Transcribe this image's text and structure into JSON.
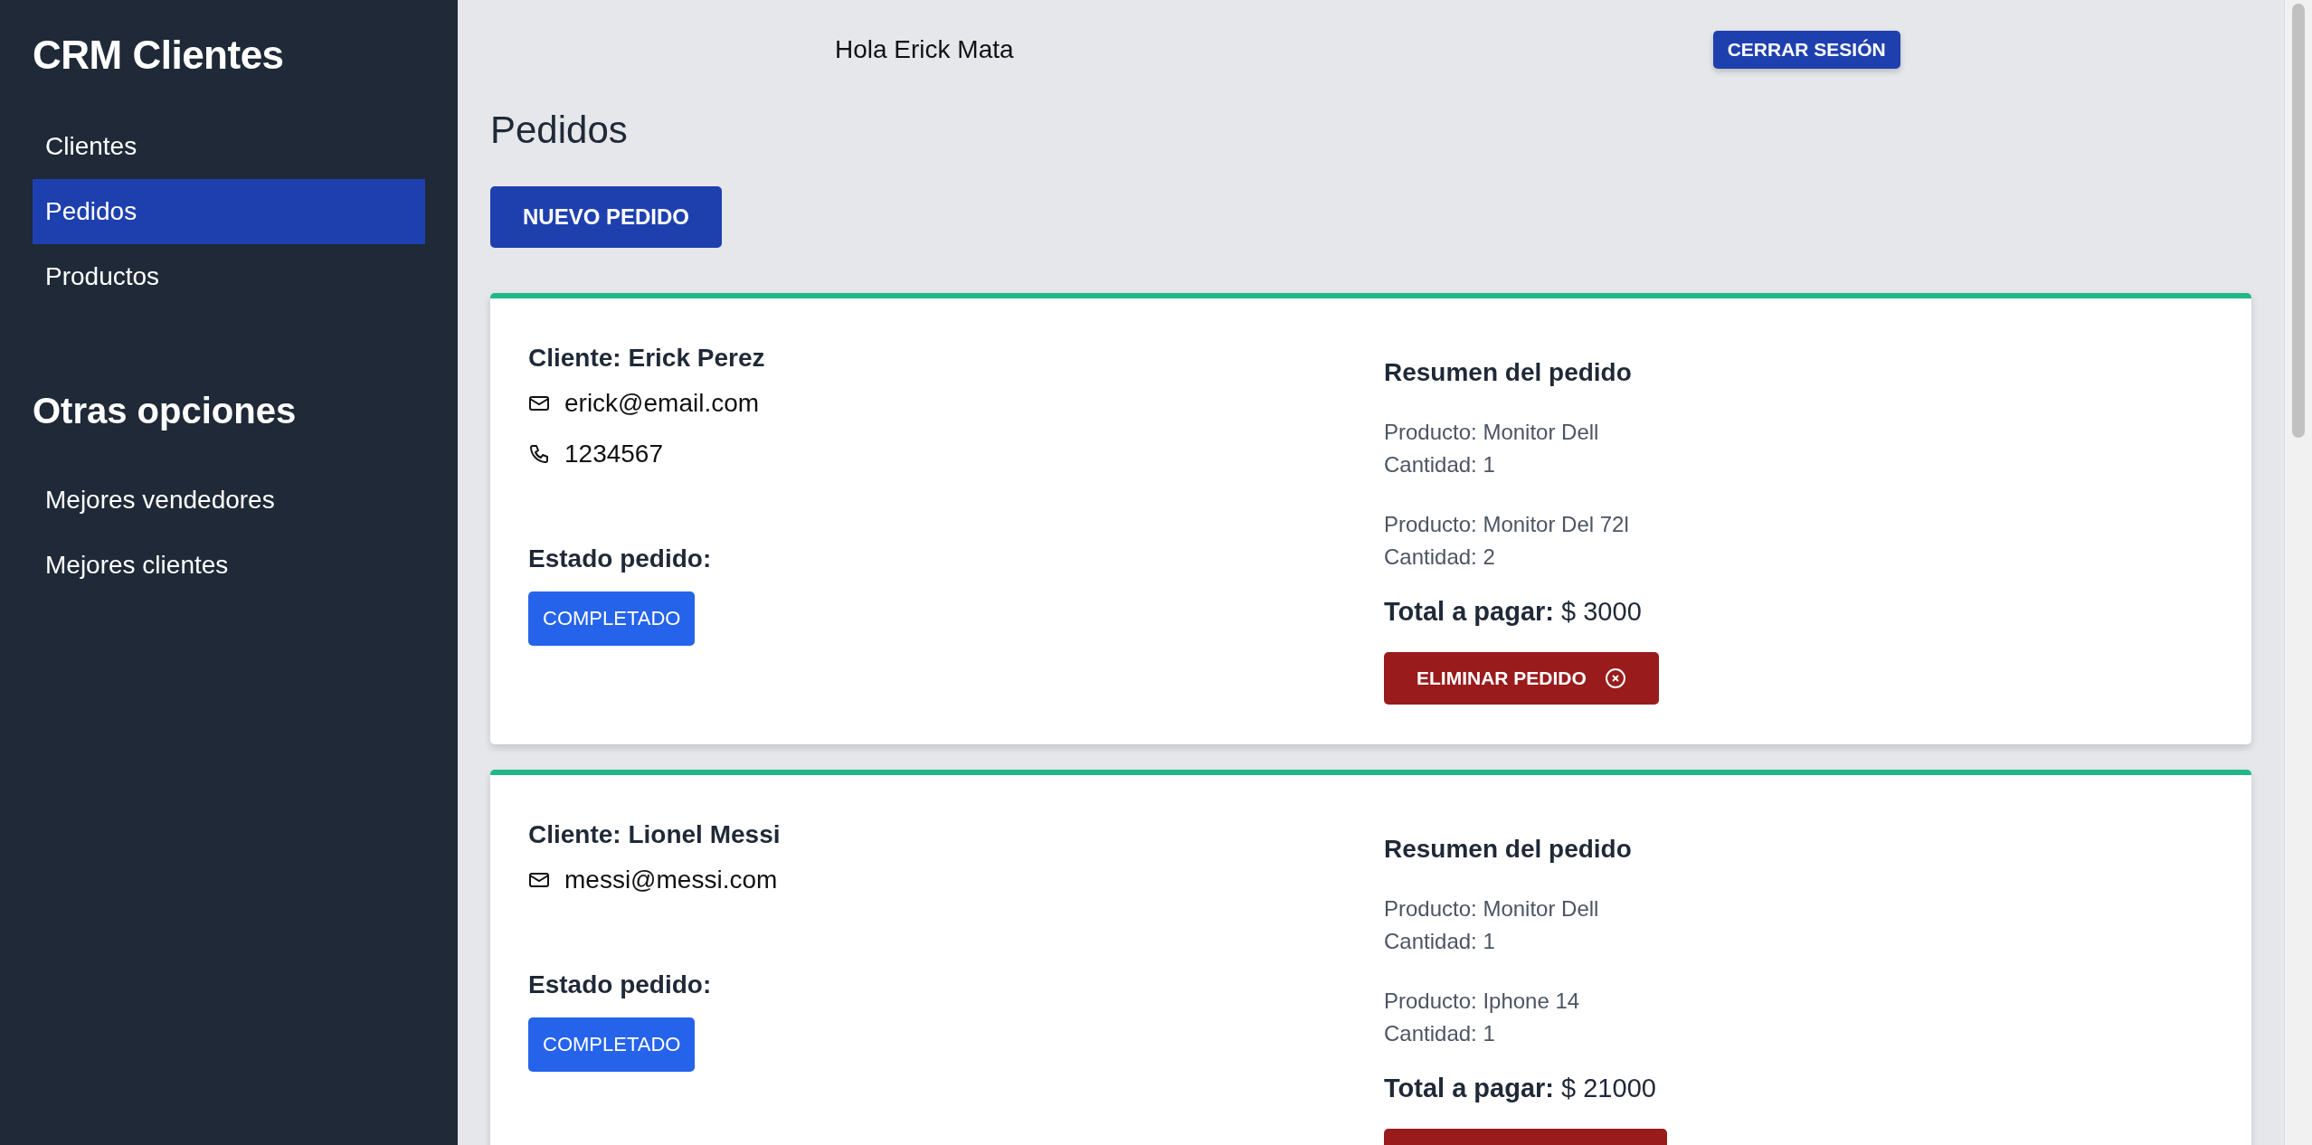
{
  "sidebar": {
    "title": "CRM Clientes",
    "items": [
      {
        "label": "Clientes",
        "selected": false
      },
      {
        "label": "Pedidos",
        "selected": true
      },
      {
        "label": "Productos",
        "selected": false
      }
    ],
    "section_title": "Otras opciones",
    "other_items": [
      {
        "label": "Mejores vendedores",
        "selected": false
      },
      {
        "label": "Mejores clientes",
        "selected": false
      }
    ]
  },
  "header": {
    "greeting": "Hola Erick Mata",
    "logout_button": "CERRAR SESIÓN"
  },
  "page_title": "Pedidos",
  "new_button": "NUEVO PEDIDO",
  "orders": [
    {
      "client": "Cliente: Erick Perez",
      "email": "erick@email.com",
      "phone": "1234567",
      "status_label": "Estado pedido:",
      "status": "COMPLETADO",
      "summary_title": "Resumen del pedido",
      "products": [
        {
          "product": "Producto: Monitor Dell",
          "quantity": "Cantidad: 1"
        },
        {
          "product": "Producto: Monitor Del 72l",
          "quantity": "Cantidad: 2"
        }
      ],
      "total": "**Total a pagar:** $ 3000",
      "delete_button": "ELIMINAR PEDIDO"
    },
    {
      "client": "Cliente: Lionel Messi",
      "email": "messi@messi.com",
      "status_label": "Estado pedido:",
      "status": "COMPLETADO",
      "summary_title": "Resumen del pedido",
      "products": [
        {
          "product": "Producto: Monitor Dell",
          "quantity": "Cantidad: 1"
        },
        {
          "product": "Producto: Iphone 14",
          "quantity": "Cantidad: 1"
        }
      ],
      "total": "**Total a pagar:** $ 21000",
      "delete_button_cut_off": true
    }
  ]
}
